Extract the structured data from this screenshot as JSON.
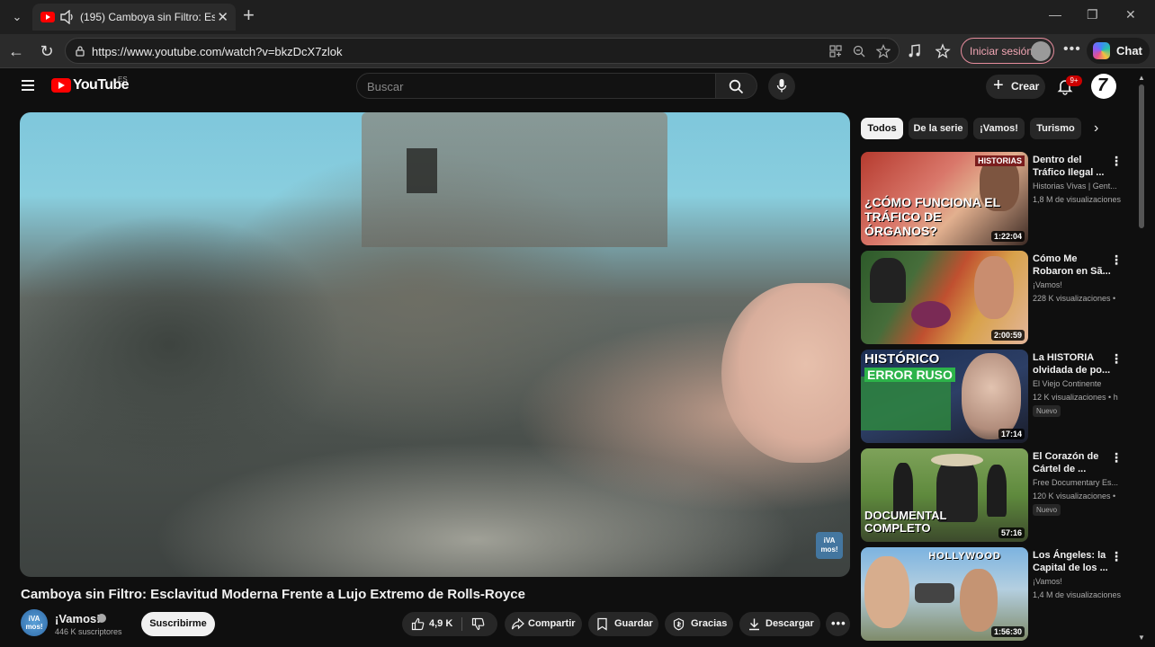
{
  "browser": {
    "tab_title": "(195) Camboya sin Filtro: Esclavitud Moderna Frente a Lujo Extremo de Rolls-Royce",
    "url": "https://www.youtube.com/watch?v=bkzDcX7zlok",
    "signin_label": "Iniciar sesión",
    "chat_label": "Chat",
    "new_tab": "+",
    "minimize": "—",
    "maximize": "❐",
    "close": "✕"
  },
  "yt": {
    "logo_text": "YouTube",
    "country": "ES",
    "search_placeholder": "Buscar",
    "create_label": "Crear",
    "notifications_badge": "9+",
    "channel_avatar_initial": "7"
  },
  "video": {
    "title": "Camboya sin Filtro: Esclavitud Moderna Frente a Lujo Extremo de Rolls-Royce",
    "watermark": "iVA mos!",
    "channel_name": "¡Vamos!",
    "channel_avatar_text": "iVA mos!",
    "subscribers": "446 K suscriptores",
    "subscribe_label": "Suscribirme",
    "likes": "4,9 K",
    "share_label": "Compartir",
    "save_label": "Guardar",
    "thanks_label": "Gracias",
    "download_label": "Descargar"
  },
  "chips": [
    "Todos",
    "De la serie",
    "¡Vamos!",
    "Turismo"
  ],
  "related": [
    {
      "title": "Dentro del Tráfico Ilegal ...",
      "channel": "Historias Vivas | Gent...",
      "views": "1,8 M de visualizaciones",
      "duration": "1:22:04",
      "thumb_text": "¿CÓMO FUNCIONA EL TRÁFICO DE ÓRGANOS?",
      "thumb_tag": "HISTORIAS",
      "badge": "",
      "colors": [
        "#c0392b",
        "#e2b08f"
      ]
    },
    {
      "title": "Cómo Me Robaron en Sã...",
      "channel": "¡Vamos!",
      "views": "228 K visualizaciones •",
      "duration": "2:00:59",
      "thumb_text": "",
      "thumb_tag": "",
      "badge": "",
      "colors": [
        "#2f6e2f",
        "#d7a24a"
      ]
    },
    {
      "title": "La HISTORIA olvidada de po...",
      "channel": "El Viejo Continente",
      "views": "12 K visualizaciones • h",
      "duration": "17:14",
      "thumb_text": "HISTÓRICO",
      "thumb_tag": "ERROR RUSO",
      "badge": "Nuevo",
      "colors": [
        "#1f7a3a",
        "#cfd6e6"
      ]
    },
    {
      "title": "El Corazón de Cártel de ...",
      "channel": "Free Documentary Es...",
      "views": "120 K visualizaciones •",
      "duration": "57:16",
      "thumb_text": "DOCUMENTAL COMPLETO",
      "thumb_tag": "",
      "badge": "Nuevo",
      "colors": [
        "#5f8a3d",
        "#a9b08a"
      ]
    },
    {
      "title": "Los Ángeles: la Capital de los ...",
      "channel": "¡Vamos!",
      "views": "1,4 M de visualizaciones",
      "duration": "1:56:30",
      "thumb_text": "",
      "thumb_tag": "HOLLYWOOD",
      "badge": "",
      "colors": [
        "#6fa7d6",
        "#d9b48a"
      ]
    }
  ]
}
